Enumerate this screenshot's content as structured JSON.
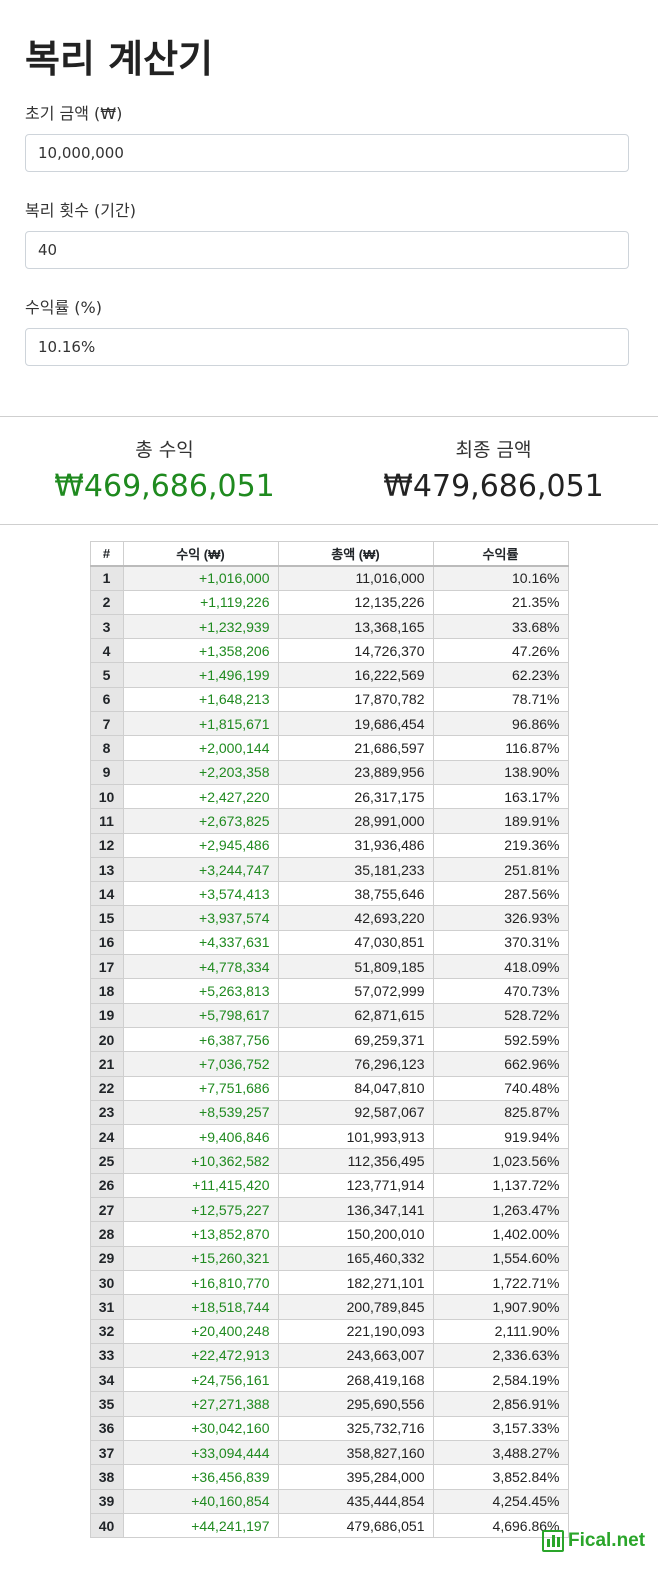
{
  "page": {
    "title": "복리 계산기"
  },
  "inputs": {
    "principal_label": "초기 금액 (₩)",
    "principal_value": "10,000,000",
    "periods_label": "복리 횟수 (기간)",
    "periods_value": "40",
    "rate_label": "수익률 (%)",
    "rate_value": "10.16%"
  },
  "summary": {
    "profit_label": "총 수익",
    "profit_value": "₩469,686,051",
    "final_label": "최종 금액",
    "final_value": "₩479,686,051"
  },
  "table": {
    "headers": [
      "#",
      "수익 (₩)",
      "총액 (₩)",
      "수익률"
    ],
    "rows": [
      [
        "1",
        "+1,016,000",
        "11,016,000",
        "10.16%"
      ],
      [
        "2",
        "+1,119,226",
        "12,135,226",
        "21.35%"
      ],
      [
        "3",
        "+1,232,939",
        "13,368,165",
        "33.68%"
      ],
      [
        "4",
        "+1,358,206",
        "14,726,370",
        "47.26%"
      ],
      [
        "5",
        "+1,496,199",
        "16,222,569",
        "62.23%"
      ],
      [
        "6",
        "+1,648,213",
        "17,870,782",
        "78.71%"
      ],
      [
        "7",
        "+1,815,671",
        "19,686,454",
        "96.86%"
      ],
      [
        "8",
        "+2,000,144",
        "21,686,597",
        "116.87%"
      ],
      [
        "9",
        "+2,203,358",
        "23,889,956",
        "138.90%"
      ],
      [
        "10",
        "+2,427,220",
        "26,317,175",
        "163.17%"
      ],
      [
        "11",
        "+2,673,825",
        "28,991,000",
        "189.91%"
      ],
      [
        "12",
        "+2,945,486",
        "31,936,486",
        "219.36%"
      ],
      [
        "13",
        "+3,244,747",
        "35,181,233",
        "251.81%"
      ],
      [
        "14",
        "+3,574,413",
        "38,755,646",
        "287.56%"
      ],
      [
        "15",
        "+3,937,574",
        "42,693,220",
        "326.93%"
      ],
      [
        "16",
        "+4,337,631",
        "47,030,851",
        "370.31%"
      ],
      [
        "17",
        "+4,778,334",
        "51,809,185",
        "418.09%"
      ],
      [
        "18",
        "+5,263,813",
        "57,072,999",
        "470.73%"
      ],
      [
        "19",
        "+5,798,617",
        "62,871,615",
        "528.72%"
      ],
      [
        "20",
        "+6,387,756",
        "69,259,371",
        "592.59%"
      ],
      [
        "21",
        "+7,036,752",
        "76,296,123",
        "662.96%"
      ],
      [
        "22",
        "+7,751,686",
        "84,047,810",
        "740.48%"
      ],
      [
        "23",
        "+8,539,257",
        "92,587,067",
        "825.87%"
      ],
      [
        "24",
        "+9,406,846",
        "101,993,913",
        "919.94%"
      ],
      [
        "25",
        "+10,362,582",
        "112,356,495",
        "1,023.56%"
      ],
      [
        "26",
        "+11,415,420",
        "123,771,914",
        "1,137.72%"
      ],
      [
        "27",
        "+12,575,227",
        "136,347,141",
        "1,263.47%"
      ],
      [
        "28",
        "+13,852,870",
        "150,200,010",
        "1,402.00%"
      ],
      [
        "29",
        "+15,260,321",
        "165,460,332",
        "1,554.60%"
      ],
      [
        "30",
        "+16,810,770",
        "182,271,101",
        "1,722.71%"
      ],
      [
        "31",
        "+18,518,744",
        "200,789,845",
        "1,907.90%"
      ],
      [
        "32",
        "+20,400,248",
        "221,190,093",
        "2,111.90%"
      ],
      [
        "33",
        "+22,472,913",
        "243,663,007",
        "2,336.63%"
      ],
      [
        "34",
        "+24,756,161",
        "268,419,168",
        "2,584.19%"
      ],
      [
        "35",
        "+27,271,388",
        "295,690,556",
        "2,856.91%"
      ],
      [
        "36",
        "+30,042,160",
        "325,732,716",
        "3,157.33%"
      ],
      [
        "37",
        "+33,094,444",
        "358,827,160",
        "3,488.27%"
      ],
      [
        "38",
        "+36,456,839",
        "395,284,000",
        "3,852.84%"
      ],
      [
        "39",
        "+40,160,854",
        "435,444,854",
        "4,254.45%"
      ],
      [
        "40",
        "+44,241,197",
        "479,686,051",
        "4,696.86%"
      ]
    ]
  },
  "footer": {
    "brand": "Fical.net",
    "icon": "bar-chart-icon"
  },
  "colors": {
    "profit_green": "#1f8a1f",
    "brand_green": "#2aa52a"
  }
}
